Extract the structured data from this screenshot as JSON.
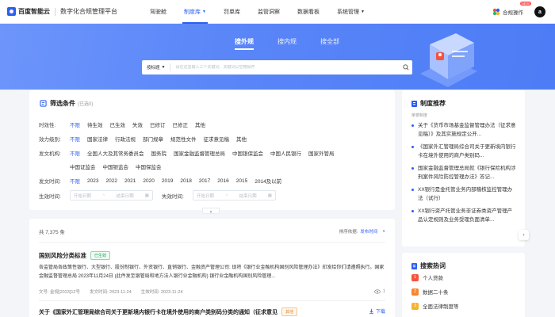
{
  "header": {
    "brand": "百度智能云",
    "platform": "数字化合规管理平台",
    "nav": [
      {
        "label": "驾驶舱",
        "active": false,
        "caret": false
      },
      {
        "label": "制度库",
        "active": true,
        "caret": true
      },
      {
        "label": "罚单库",
        "active": false,
        "caret": false
      },
      {
        "label": "监管洞察",
        "active": false,
        "caret": false
      },
      {
        "label": "数据看板",
        "active": false,
        "caret": false
      },
      {
        "label": "系统管理",
        "active": false,
        "caret": true
      }
    ],
    "favorites_label": "合规操作",
    "new_badge": "NEW",
    "avatar_letter": "a"
  },
  "banner": {
    "tabs": [
      "搜外规",
      "搜内规",
      "搜全部"
    ],
    "search_scope": "按标题",
    "search_placeholder": "请在这里输入三个关键词、关键词以空格隔开"
  },
  "filter": {
    "title": "筛选条件",
    "count_note": "(已选0)",
    "rows": [
      {
        "label": "时效性:",
        "options": [
          "不限",
          "待生效",
          "已生效",
          "失效",
          "已修订",
          "已修正",
          "其他"
        ]
      },
      {
        "label": "效力级别:",
        "options": [
          "不限",
          "国家法律",
          "行政法规",
          "部门规章",
          "规范性文件",
          "征求意见稿",
          "其他"
        ]
      },
      {
        "label": "发文机构:",
        "options": [
          "不限",
          "全国人大及其常务委员会",
          "国务院",
          "国家金融监督管理总局",
          "中国银保监会",
          "中国人民银行",
          "国家外管局"
        ]
      },
      {
        "label": "",
        "options": [
          "中国证监会",
          "中国银监会",
          "中国保监会"
        ]
      },
      {
        "label": "发文时间:",
        "options": [
          "不限",
          "2023",
          "2022",
          "2021",
          "2020",
          "2019",
          "2018",
          "2017",
          "2016",
          "2015",
          "2014及以前"
        ]
      }
    ],
    "effective_label": "生效时间:",
    "invalid_label": "失效时间:",
    "date_start": "开始日期",
    "date_end": "结束日期",
    "date_sep": "~"
  },
  "results": {
    "total": "共 7,375 条",
    "sort_label": "排序依据:",
    "sort_value": "发布时间",
    "items": [
      {
        "title": "国别风险分类标准",
        "tag": "已生效",
        "tag_color": "green",
        "excerpt": "各监管局各政策性银行、大型银行、股份制银行、外资银行、直销银行、金融资产管理公司: 现将《银行业金融机构国别风险管理办法》印发给你们请遵照执行。国家金融监督管理总局 2023年11月24日 (此件发至银管局和地方法人银行业金融机构) 银行业金融机构国别风险管理...",
        "doc_no": "文号: 金规[2023]12号",
        "publish": "发文时间: 2023-11-24",
        "effective": "生效时间: 2023-11-24",
        "views": "1"
      },
      {
        "title": "关于《国家外汇管理局综合司关于更新境内银行卡在境外使用的商户类别码分类的通知（征求意见",
        "tag": "其他",
        "tag_color": "orange",
        "download": "下载"
      }
    ]
  },
  "recommend": {
    "title": "制度推荐",
    "subtitle": "荣誉制度",
    "items": [
      "关于《货币市场基金监督管理办法（征求意见稿）》及其实施规定公开...",
      "《国家外汇管理局综合司关于更新境内银行卡在境外使用的商户类别码...",
      "国家金融监督管理总局就《银行保险机构涉刑案件风险防控管理办法》答记...",
      "XX银行是金托管业务内部稽核监控管理办法（试行）",
      "XX银行资产托管业务非证券类资产管理产品认定规则及业务受理负面清单..."
    ]
  },
  "hot": {
    "title": "搜索热词",
    "items": [
      {
        "rank": "1",
        "word": "个人贷款"
      },
      {
        "rank": "2",
        "word": "数据二十条"
      },
      {
        "rank": "3",
        "word": "全面法律制度等"
      }
    ]
  },
  "colors": {
    "accent": "#2b5ef5",
    "banner": "#5a86f8"
  }
}
